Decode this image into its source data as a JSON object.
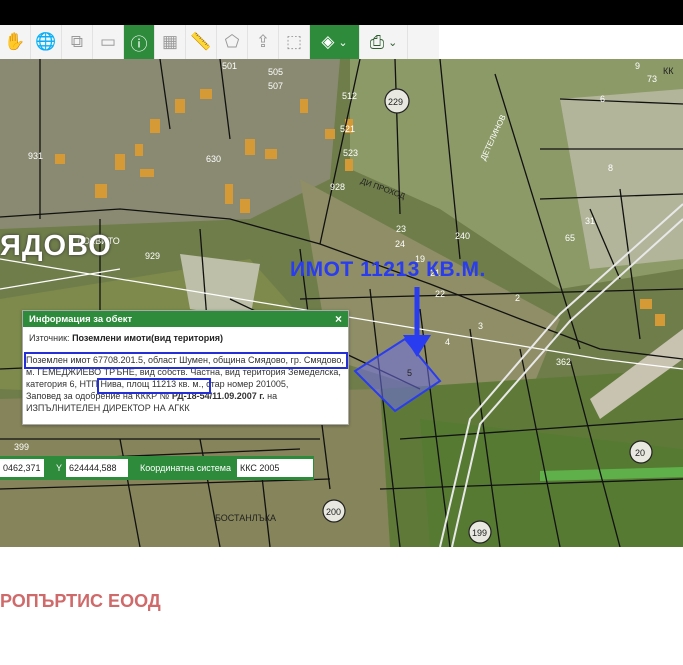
{
  "toolbar": {
    "icons": [
      "hand-icon",
      "globe-icon",
      "window-export-icon",
      "window-icon",
      "info-icon",
      "area-measure-icon",
      "ruler-icon",
      "polygon-icon",
      "upload-icon",
      "select-rectangle-icon",
      "layers-icon",
      "print-icon"
    ],
    "layers_caret": "⌄",
    "print_caret": "⌄"
  },
  "map": {
    "town_label": "ЯДОВО",
    "locality_label": "ЛОКВИТО",
    "locality_label_2": "БОСТАНЛЪКА",
    "road_label": "ДЕТЕЛИНОВ",
    "road_label_2": "ДИ ПРОХОД",
    "annotation": "ИМОТ 11213 КВ.М.",
    "region_labels": [
      "229",
      "200",
      "199",
      "20"
    ],
    "parcel_numbers": [
      "501",
      "505",
      "507",
      "630",
      "931",
      "928",
      "929",
      "512",
      "521",
      "523",
      "23",
      "24",
      "240",
      "19",
      "21",
      "22",
      "5",
      "4",
      "3",
      "362",
      "399",
      "2",
      "31",
      "65",
      "6",
      "73",
      "9",
      "8",
      "16"
    ],
    "stripe_label": "КК"
  },
  "info_panel": {
    "title": "Информация за обект",
    "close": "×",
    "source_label": "Източник:",
    "source_value": "Поземлени имоти(вид територия)",
    "line1": "Поземлен имот 67708.201.5, област Шумен, община Смядово, гр. Смядово,",
    "line2": "м. ГЕМЕДЖИЕВО ТРЪНЕ, вид собств. Частна, вид територия Земеделска,",
    "line3a": "категория 6, НТП",
    "line3b": "Нива, площ 11213 кв. м.,",
    "line3c": "стар номер 201005,",
    "line4a": "Заповед за одобрение на КККР №",
    "line4b": "РД-18-54/11.09.2007 г.",
    "line4c": "на",
    "line5": "ИЗПЪЛНИТЕЛЕН ДИРЕКТОР НА АГКК"
  },
  "coords": {
    "x_value": "0462,371",
    "y_label": "Y",
    "y_value": "624444,588",
    "system_label": "Координатна система",
    "system_value": "ККС 2005"
  },
  "footer": {
    "company": "РОПЪРТИС ЕООД"
  },
  "colors": {
    "accent": "#2e8b3c",
    "annotation": "#2a3cf0",
    "company": "#d06a6a"
  }
}
